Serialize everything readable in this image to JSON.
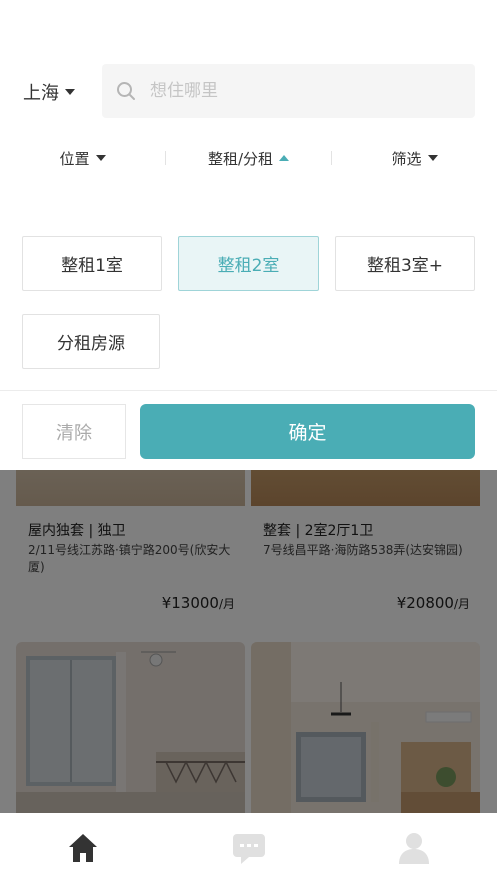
{
  "header": {
    "city": "上海",
    "search_placeholder": "想住哪里"
  },
  "filters": [
    {
      "label": "位置"
    },
    {
      "label": "整租/分租"
    },
    {
      "label": "筛选"
    }
  ],
  "rent_options": {
    "items": [
      "整租1室",
      "整租2室",
      "整租3室+",
      "分租房源"
    ],
    "selected": "整租2室"
  },
  "actions": {
    "clear_label": "清除",
    "confirm_label": "确定"
  },
  "listings": [
    {
      "title": "屋内独套 | 独卫",
      "address": "2/11号线江苏路·镇宁路200号(欣安大厦)",
      "price": "¥13000",
      "unit": "/月"
    },
    {
      "title": "整套 | 2室2厅1卫",
      "address": "7号线昌平路·海防路538弄(达安锦园)",
      "price": "¥20800",
      "unit": "/月"
    }
  ],
  "bottom_nav": {
    "icons": [
      "home-icon",
      "message-icon",
      "profile-icon"
    ]
  },
  "colors": {
    "accent": "#4aadb5",
    "selected_bg": "#e9f5f6",
    "overlay": "rgba(0,0,0,0.5)"
  }
}
